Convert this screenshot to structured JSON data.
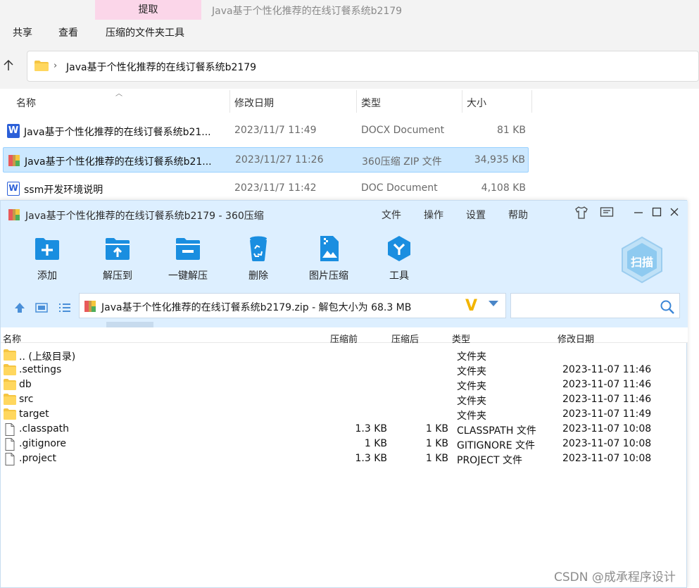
{
  "explorer": {
    "extract_tab": "提取",
    "title": "Java基于个性化推荐的在线订餐系统b2179",
    "tabs": [
      "共享",
      "查看",
      "压缩的文件夹工具"
    ],
    "address": "Java基于个性化推荐的在线订餐系统b2179",
    "columns": {
      "name": "名称",
      "date": "修改日期",
      "type": "类型",
      "size": "大小"
    },
    "files": [
      {
        "name": "Java基于个性化推荐的在线订餐系统b21...",
        "date": "2023/11/7 11:49",
        "type": "DOCX Document",
        "size": "81 KB",
        "icon": "word-docx-icon"
      },
      {
        "name": "Java基于个性化推荐的在线订餐系统b21...",
        "date": "2023/11/27 11:26",
        "type": "360压缩 ZIP 文件",
        "size": "34,935 KB",
        "icon": "zip-archive-icon",
        "selected": true
      },
      {
        "name": "ssm开发环境说明",
        "date": "2023/11/7 11:42",
        "type": "DOC Document",
        "size": "4,108 KB",
        "icon": "word-doc-icon"
      }
    ]
  },
  "zip": {
    "title": "Java基于个性化推荐的在线订餐系统b2179 - 360压缩",
    "menu": [
      "文件",
      "操作",
      "设置",
      "帮助"
    ],
    "toolbar": [
      "添加",
      "解压到",
      "一键解压",
      "删除",
      "图片压缩",
      "工具"
    ],
    "scan_label": "扫描",
    "path": "Java基于个性化推荐的在线订餐系统b2179.zip - 解包大小为 68.3 MB",
    "columns": {
      "name": "名称",
      "before": "压缩前",
      "after": "压缩后",
      "type": "类型",
      "date": "修改日期"
    },
    "rows": [
      {
        "name": ".. (上级目录)",
        "before": "",
        "after": "",
        "type": "文件夹",
        "date": "",
        "kind": "folder"
      },
      {
        "name": ".settings",
        "before": "",
        "after": "",
        "type": "文件夹",
        "date": "2023-11-07 11:46",
        "kind": "folder"
      },
      {
        "name": "db",
        "before": "",
        "after": "",
        "type": "文件夹",
        "date": "2023-11-07 11:46",
        "kind": "folder"
      },
      {
        "name": "src",
        "before": "",
        "after": "",
        "type": "文件夹",
        "date": "2023-11-07 11:46",
        "kind": "folder"
      },
      {
        "name": "target",
        "before": "",
        "after": "",
        "type": "文件夹",
        "date": "2023-11-07 11:49",
        "kind": "folder"
      },
      {
        "name": ".classpath",
        "before": "1.3 KB",
        "after": "1 KB",
        "type": "CLASSPATH 文件",
        "date": "2023-11-07 10:08",
        "kind": "file"
      },
      {
        "name": ".gitignore",
        "before": "1 KB",
        "after": "1 KB",
        "type": "GITIGNORE 文件",
        "date": "2023-11-07 10:08",
        "kind": "file"
      },
      {
        "name": ".project",
        "before": "1.3 KB",
        "after": "1 KB",
        "type": "PROJECT 文件",
        "date": "2023-11-07 10:08",
        "kind": "file"
      }
    ]
  },
  "watermark": "CSDN @成承程序设计",
  "colors": {
    "selection": "#cce8ff",
    "zip_header": "#ddefff",
    "accent_blue": "#1a8ee0",
    "extract_tab": "#fbd6e9"
  }
}
